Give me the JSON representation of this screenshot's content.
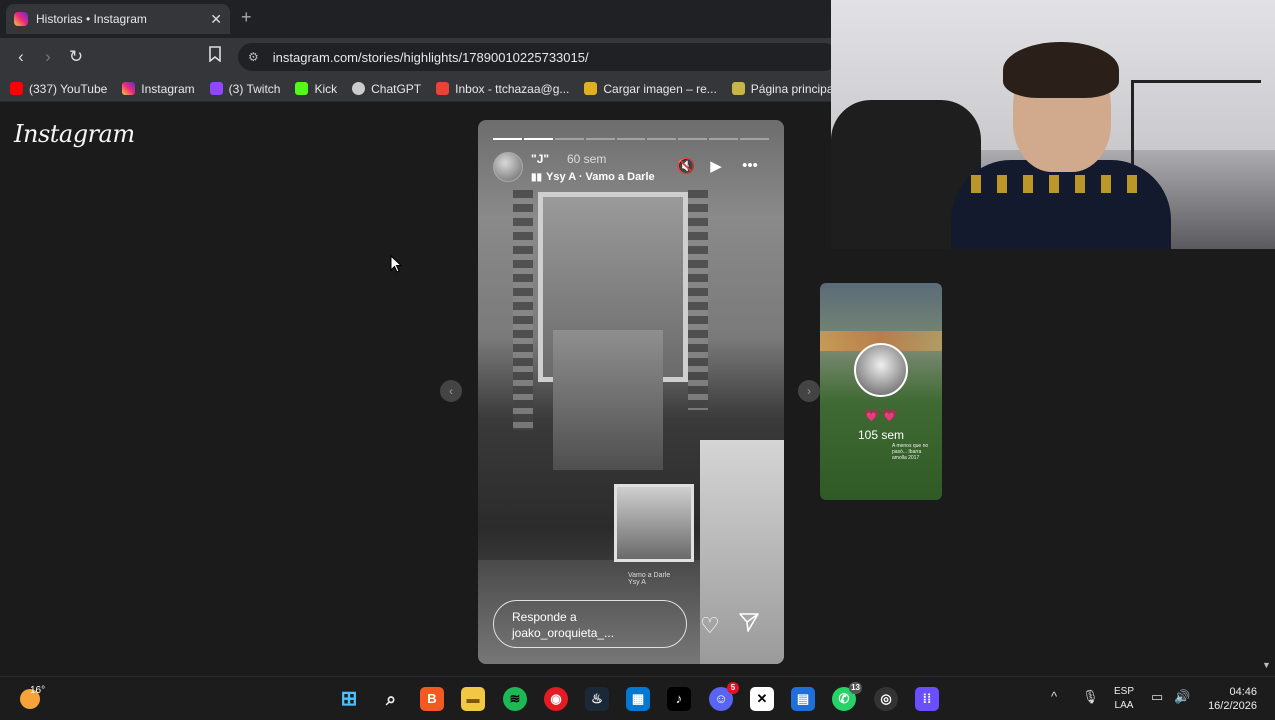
{
  "browser": {
    "tab_title": "Historias • Instagram",
    "tab_close": "✕",
    "new_tab": "+",
    "url": "instagram.com/stories/highlights/17890010225733015/",
    "bookmarks": [
      {
        "label": "(337) YouTube",
        "color": "#ff0000"
      },
      {
        "label": "Instagram",
        "color": "#e1306c"
      },
      {
        "label": "(3) Twitch",
        "color": "#9146ff"
      },
      {
        "label": "Kick",
        "color": "#53fc18"
      },
      {
        "label": "ChatGPT",
        "color": "#cccccc"
      },
      {
        "label": "Inbox - ttchazaa@g...",
        "color": "#ea4335"
      },
      {
        "label": "Cargar imagen – re...",
        "color": "#e0b020"
      },
      {
        "label": "Página principal",
        "color": "#c9b545"
      }
    ]
  },
  "page": {
    "logo": "Instagram",
    "story": {
      "progress_total": 9,
      "progress_done": 2,
      "username": "\"J\"",
      "time_ago": "60 sem",
      "song": "Ysy A · Vamo a Darle",
      "reply_placeholder": "Responde a joako_oroquieta_...",
      "sticker_caption": "Vamo a Darle\nYsy A"
    },
    "next_story": {
      "hearts": "💗 💗",
      "time_ago": "105 sem",
      "scribble": "A menos que no pasó... Ibarra amolla 2017"
    }
  },
  "taskbar": {
    "temperature": "16°",
    "language_top": "ESP",
    "language_bottom": "LAA",
    "time": "04:46",
    "date": "16/2/2026",
    "discord_badge": "5",
    "whatsapp_badge": "13"
  }
}
